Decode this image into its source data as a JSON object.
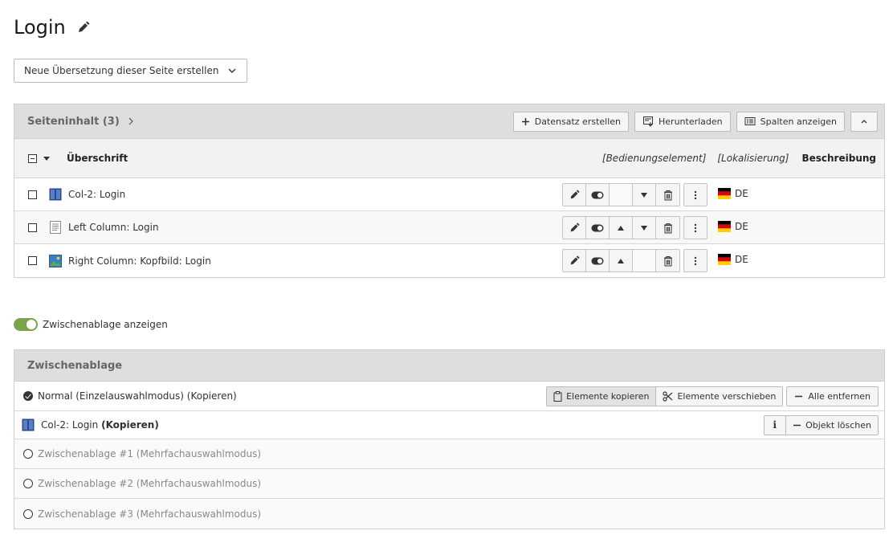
{
  "page": {
    "title": "Login"
  },
  "language_select": {
    "value": "Neue Übersetzung dieser Seite erstellen"
  },
  "content_panel": {
    "title": "Seiteninhalt (3)",
    "buttons": {
      "create": "Datensatz erstellen",
      "download": "Herunterladen",
      "columns": "Spalten anzeigen"
    },
    "columns": {
      "title": "Überschrift",
      "control": "[Bedienungselement]",
      "localization": "[Lokalisierung]",
      "description": "Beschreibung"
    },
    "rows": [
      {
        "label": "Col-2: Login",
        "type_icon": "columns-icon",
        "lang": "DE"
      },
      {
        "label": "Left Column: Login",
        "type_icon": "text-icon",
        "lang": "DE"
      },
      {
        "label": "Right Column: Kopfbild: Login",
        "type_icon": "image-icon",
        "lang": "DE"
      }
    ]
  },
  "clipboard_toggle": {
    "label": "Zwischenablage anzeigen",
    "on": true
  },
  "clipboard": {
    "title": "Zwischenablage",
    "modes": [
      {
        "label": "Normal (Einzelauswahlmodus) (Kopieren)",
        "selected": true
      },
      {
        "label": "Zwischenablage #1 (Mehrfachauswahlmodus)",
        "selected": false
      },
      {
        "label": "Zwischenablage #2 (Mehrfachauswahlmodus)",
        "selected": false
      },
      {
        "label": "Zwischenablage #3 (Mehrfachauswahlmodus)",
        "selected": false
      }
    ],
    "buttons": {
      "copy": "Elemente kopieren",
      "move": "Elemente verschieben",
      "remove_all": "Alle entfernen",
      "info": "i",
      "delete_object": "Objekt löschen"
    },
    "item": {
      "label": "Col-2: Login",
      "suffix": "(Kopieren)"
    }
  },
  "colors": {
    "toggle_on": "#79a548",
    "panel_header": "#dedede",
    "flag_black": "#000000",
    "flag_red": "#dd0000",
    "flag_gold": "#ffce00"
  }
}
